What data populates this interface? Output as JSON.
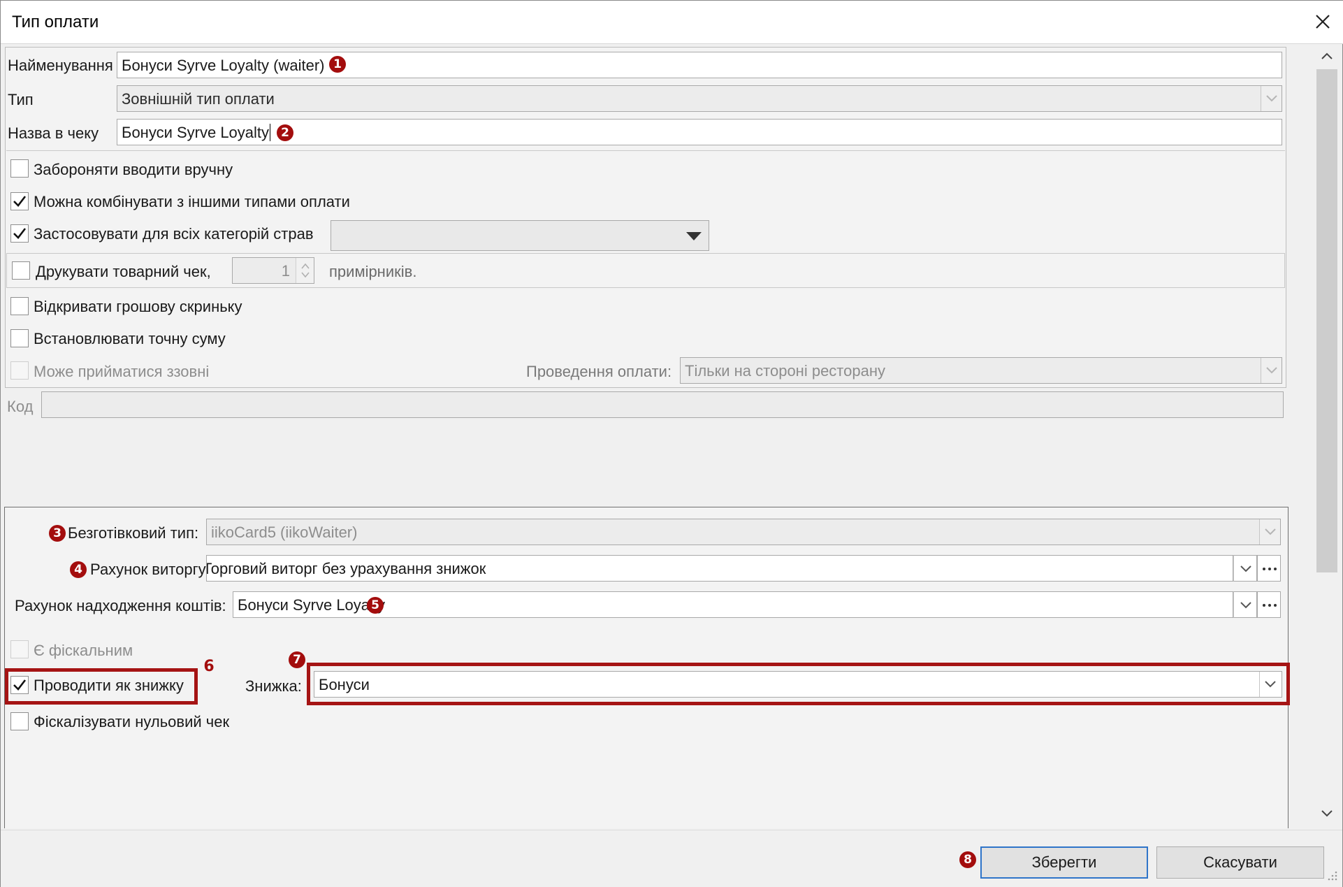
{
  "window": {
    "title": "Тип оплати"
  },
  "form": {
    "name_label": "Найменування",
    "name_value": "Бонуси Syrve Loyalty (waiter)",
    "type_label": "Тип",
    "type_value": "Зовнішній тип оплати",
    "receipt_name_label": "Назва в чеку",
    "receipt_name_value": "Бонуси Syrve Loyalty",
    "forbid_manual_label": "Забороняти вводити вручну",
    "forbid_manual_checked": false,
    "combine_label": "Можна комбінувати з іншими типами оплати",
    "combine_checked": true,
    "all_categories_label": "Застосовувати для всіх категорій страв",
    "all_categories_checked": true,
    "all_categories_select_value": "",
    "print_receipt_label": "Друкувати товарний чек,",
    "print_receipt_checked": false,
    "print_copies_value": "1",
    "print_copies_suffix": "примірників.",
    "open_drawer_label": "Відкривати грошову скриньку",
    "open_drawer_checked": false,
    "exact_sum_label": "Встановлювати точну суму",
    "exact_sum_checked": false,
    "external_accept_label": "Може прийматися ззовні",
    "external_accept_checked": false,
    "processing_label": "Проведення оплати:",
    "processing_value": "Тільки на стороні ресторану",
    "code_label": "Код",
    "code_value": ""
  },
  "details": {
    "cashless_type_label": "Безготівковий тип:",
    "cashless_type_value": "iikoCard5 (iikoWaiter)",
    "revenue_account_label": "Рахунок виторгу:",
    "revenue_account_value": "Торговий виторг без урахування знижок",
    "income_account_label": "Рахунок надходження коштів:",
    "income_account_value": "Бонуси Syrve Loyalty",
    "fiscal_label": "Є фіскальним",
    "fiscal_checked": false,
    "as_discount_label": "Проводити як знижку",
    "as_discount_checked": true,
    "discount_label": "Знижка:",
    "discount_value": "Бонуси",
    "fiscalize_zero_label": "Фіскалізувати нульовий чек",
    "fiscalize_zero_checked": false
  },
  "markers": {
    "m1": "1",
    "m2": "2",
    "m3": "3",
    "m4": "4",
    "m5": "5",
    "m6": "6",
    "m7": "7",
    "m8": "8"
  },
  "buttons": {
    "save": "Зберегти",
    "cancel": "Скасувати"
  },
  "colors": {
    "marker_red": "#a30d0d",
    "highlight_red": "#a51414",
    "primary_border": "#2f74c9"
  }
}
